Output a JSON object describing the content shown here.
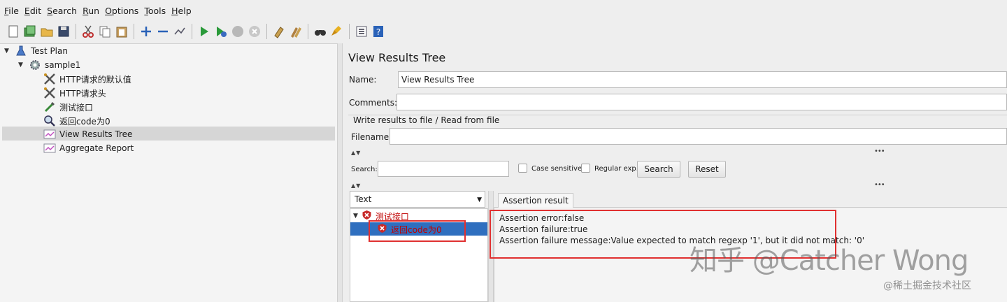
{
  "menu": [
    "File",
    "Edit",
    "Search",
    "Run",
    "Options",
    "Tools",
    "Help"
  ],
  "toolbar_icons": [
    "new-icon",
    "templates-icon",
    "open-icon",
    "save-icon",
    "cut-icon",
    "copy-icon",
    "paste-icon",
    "expand-icon",
    "collapse-icon",
    "toggle-icon",
    "start-icon",
    "start-no-pause-icon",
    "stop-icon",
    "shutdown-icon",
    "clear-icon",
    "clear-all-icon",
    "search-icon",
    "reset-search-icon",
    "function-helper-icon",
    "help-icon"
  ],
  "tree": {
    "test_plan": "Test Plan",
    "thread_group": "sample1",
    "items": [
      {
        "label": "HTTP请求的默认值",
        "icon": "wrench-icon"
      },
      {
        "label": "HTTP请求头",
        "icon": "wrench-icon"
      },
      {
        "label": "测试接口",
        "icon": "pipette-icon"
      },
      {
        "label": "返回code为0",
        "icon": "magnifier-icon"
      },
      {
        "label": "View Results Tree",
        "icon": "chart-icon",
        "selected": true
      },
      {
        "label": "Aggregate Report",
        "icon": "chart-icon"
      }
    ]
  },
  "panel": {
    "title": "View Results Tree",
    "name_label": "Name:",
    "name_value": "View Results Tree",
    "comments_label": "Comments:",
    "comments_value": "",
    "file_group_label": "Write results to file / Read from file",
    "filename_label": "Filename",
    "filename_value": ""
  },
  "search": {
    "label": "Search:",
    "value": "",
    "case_sensitive": "Case sensitive",
    "regular_exp": "Regular exp.",
    "search_button": "Search",
    "reset_button": "Reset"
  },
  "renderer": {
    "selected": "Text"
  },
  "results": {
    "parent": "测试接口",
    "child": "返回code为0",
    "tab": "Assertion result",
    "lines": [
      "Assertion error:false",
      "Assertion failure:true",
      "Assertion failure message:Value expected to match regexp '1', but it did not match: '0'"
    ]
  },
  "watermark": {
    "main": "知乎 @Catcher Wong",
    "sub": "@稀土掘金技术社区"
  },
  "colors": {
    "highlight": "#e03030",
    "selection": "#2f6fbf",
    "error_text": "#c00000"
  }
}
